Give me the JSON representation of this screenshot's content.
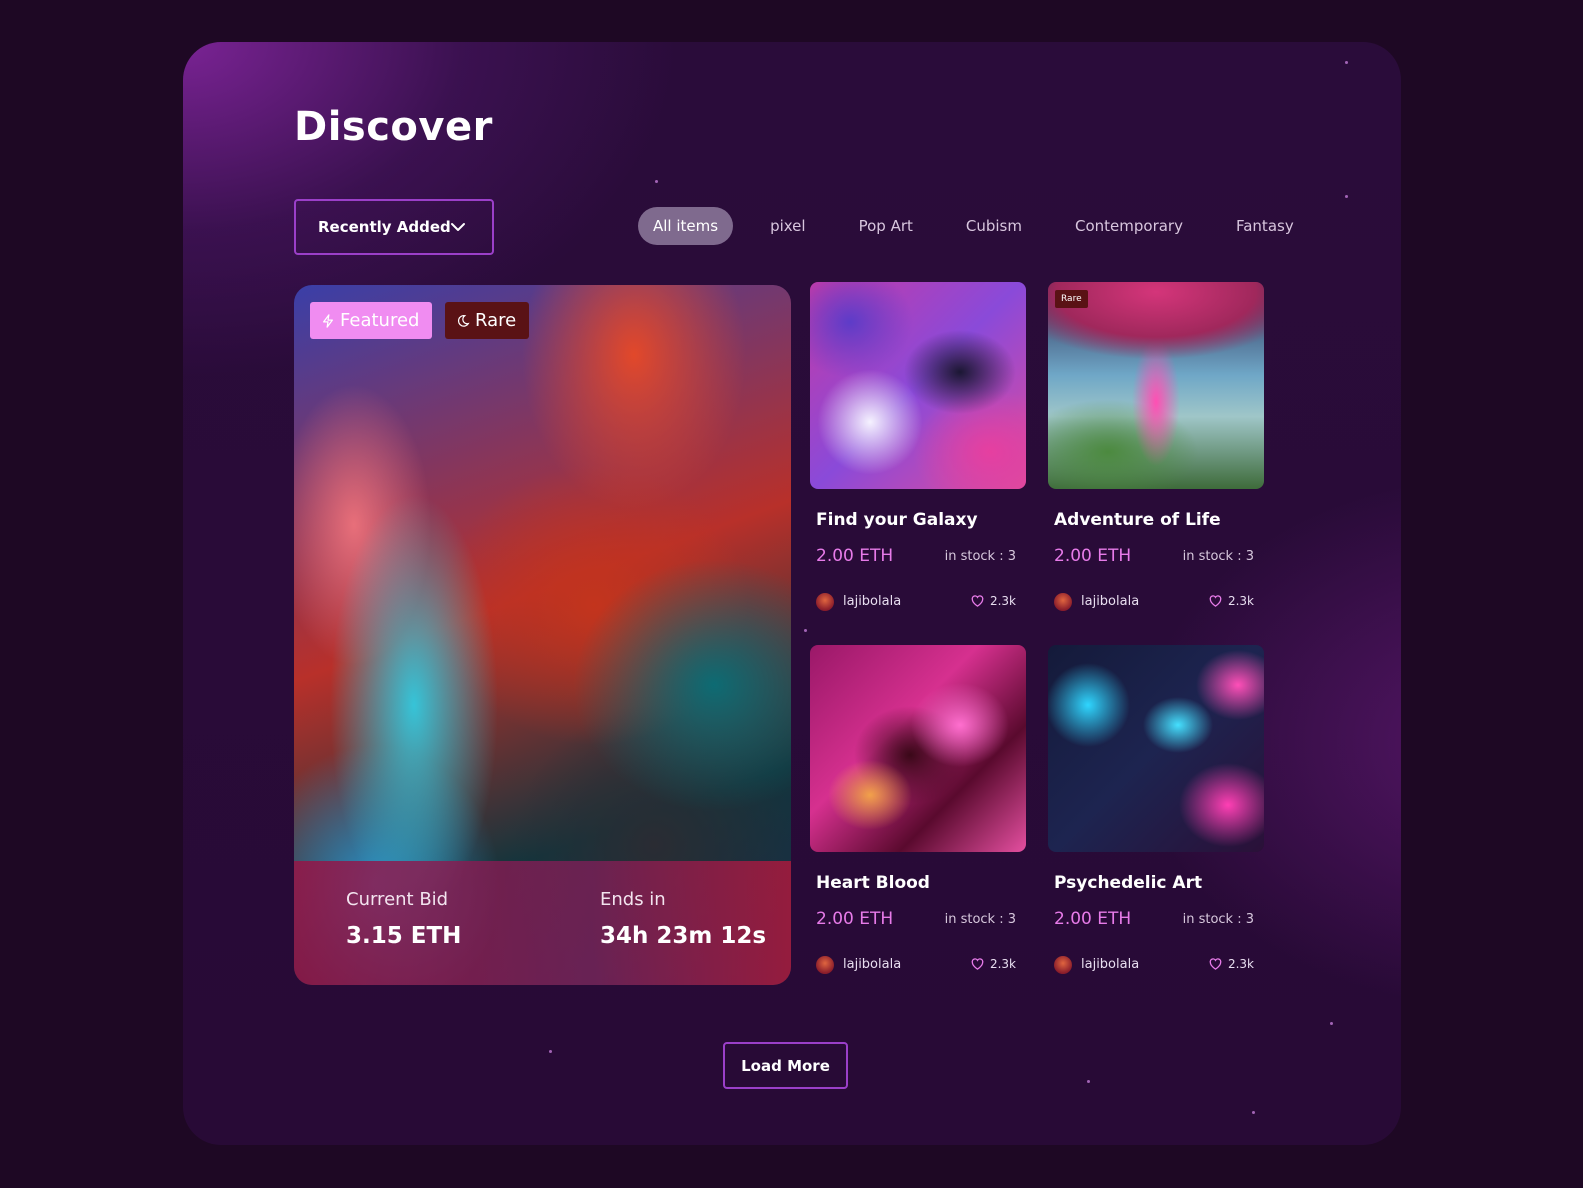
{
  "page": {
    "title": "Discover"
  },
  "sort": {
    "label": "Recently Added"
  },
  "filters": {
    "tabs": [
      {
        "label": "All items",
        "active": true
      },
      {
        "label": "pixel",
        "active": false
      },
      {
        "label": "Pop Art",
        "active": false
      },
      {
        "label": "Cubism",
        "active": false
      },
      {
        "label": "Contemporary",
        "active": false
      },
      {
        "label": "Fantasy",
        "active": false
      }
    ]
  },
  "featured": {
    "badge_featured": "Featured",
    "badge_rare": "Rare",
    "bid_label": "Current Bid",
    "bid_value": "3.15 ETH",
    "ends_label": "Ends in",
    "ends_value": "34h 23m 12s"
  },
  "cards": [
    {
      "name": "Find your Galaxy",
      "price": "2.00 ETH",
      "stock": "in stock : 3",
      "owner": "lajibolala",
      "likes": "2.3k",
      "rare": false
    },
    {
      "name": "Adventure of Life",
      "price": "2.00 ETH",
      "stock": "in stock : 3",
      "owner": "lajibolala",
      "likes": "2.3k",
      "rare": true,
      "rare_label": "Rare"
    },
    {
      "name": "Heart Blood",
      "price": "2.00 ETH",
      "stock": "in stock : 3",
      "owner": "lajibolala",
      "likes": "2.3k",
      "rare": false
    },
    {
      "name": "Psychedelic Art",
      "price": "2.00 ETH",
      "stock": "in stock : 3",
      "owner": "lajibolala",
      "likes": "2.3k",
      "rare": false
    }
  ],
  "load_more": {
    "label": "Load More"
  },
  "colors": {
    "background": "#1e0824",
    "accent": "#9b3fc9",
    "price": "#e77be9",
    "featured_badge": "#f08cf1",
    "rare_badge": "#5a1215"
  },
  "icons": {
    "sort": "chevron-down-icon",
    "featured": "lightning-icon",
    "rare": "moon-icon",
    "likes": "heart-icon"
  }
}
